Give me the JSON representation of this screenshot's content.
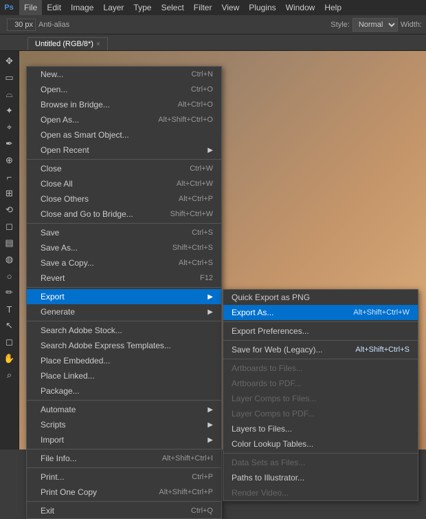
{
  "app": {
    "icon": "Ps",
    "title": "Photoshop"
  },
  "menubar": {
    "items": [
      {
        "id": "file",
        "label": "File",
        "active": true
      },
      {
        "id": "edit",
        "label": "Edit"
      },
      {
        "id": "image",
        "label": "Image"
      },
      {
        "id": "layer",
        "label": "Layer"
      },
      {
        "id": "type",
        "label": "Type"
      },
      {
        "id": "select",
        "label": "Select"
      },
      {
        "id": "filter",
        "label": "Filter"
      },
      {
        "id": "view",
        "label": "View"
      },
      {
        "id": "plugins",
        "label": "Plugins"
      },
      {
        "id": "window",
        "label": "Window"
      },
      {
        "id": "help",
        "label": "Help"
      }
    ]
  },
  "toolbar": {
    "size_value": "30 px",
    "anti_alias_label": "Anti-alias",
    "style_label": "Style:",
    "style_value": "Normal",
    "width_label": "Width:"
  },
  "tab": {
    "name": "Untitled (RGB/8*)",
    "close": "×"
  },
  "file_menu": {
    "items": [
      {
        "id": "new",
        "label": "New...",
        "shortcut": "Ctrl+N",
        "has_sub": false,
        "disabled": false
      },
      {
        "id": "open",
        "label": "Open...",
        "shortcut": "Ctrl+O",
        "has_sub": false,
        "disabled": false
      },
      {
        "id": "browse_in_bridge",
        "label": "Browse in Bridge...",
        "shortcut": "Alt+Ctrl+O",
        "has_sub": false,
        "disabled": false
      },
      {
        "id": "open_as",
        "label": "Open As...",
        "shortcut": "Alt+Shift+Ctrl+O",
        "has_sub": false,
        "disabled": false
      },
      {
        "id": "open_smart_object",
        "label": "Open as Smart Object...",
        "shortcut": "",
        "has_sub": false,
        "disabled": false
      },
      {
        "id": "open_recent",
        "label": "Open Recent",
        "shortcut": "",
        "has_sub": true,
        "disabled": false
      },
      {
        "id": "div1",
        "type": "divider"
      },
      {
        "id": "close",
        "label": "Close",
        "shortcut": "Ctrl+W",
        "has_sub": false,
        "disabled": false
      },
      {
        "id": "close_all",
        "label": "Close All",
        "shortcut": "Alt+Ctrl+W",
        "has_sub": false,
        "disabled": false
      },
      {
        "id": "close_others",
        "label": "Close Others",
        "shortcut": "Alt+Ctrl+P",
        "has_sub": false,
        "disabled": false
      },
      {
        "id": "close_go_bridge",
        "label": "Close and Go to Bridge...",
        "shortcut": "Shift+Ctrl+W",
        "has_sub": false,
        "disabled": false
      },
      {
        "id": "div2",
        "type": "divider"
      },
      {
        "id": "save",
        "label": "Save",
        "shortcut": "Ctrl+S",
        "has_sub": false,
        "disabled": false
      },
      {
        "id": "save_as",
        "label": "Save As...",
        "shortcut": "Shift+Ctrl+S",
        "has_sub": false,
        "disabled": false
      },
      {
        "id": "save_copy",
        "label": "Save a Copy...",
        "shortcut": "Alt+Ctrl+S",
        "has_sub": false,
        "disabled": false
      },
      {
        "id": "revert",
        "label": "Revert",
        "shortcut": "F12",
        "has_sub": false,
        "disabled": false
      },
      {
        "id": "div3",
        "type": "divider"
      },
      {
        "id": "export",
        "label": "Export",
        "shortcut": "",
        "has_sub": true,
        "disabled": false,
        "highlighted": true
      },
      {
        "id": "generate",
        "label": "Generate",
        "shortcut": "",
        "has_sub": true,
        "disabled": false
      },
      {
        "id": "div4",
        "type": "divider"
      },
      {
        "id": "search_stock",
        "label": "Search Adobe Stock...",
        "shortcut": "",
        "has_sub": false,
        "disabled": false
      },
      {
        "id": "search_express",
        "label": "Search Adobe Express Templates...",
        "shortcut": "",
        "has_sub": false,
        "disabled": false
      },
      {
        "id": "place_embedded",
        "label": "Place Embedded...",
        "shortcut": "",
        "has_sub": false,
        "disabled": false
      },
      {
        "id": "place_linked",
        "label": "Place Linked...",
        "shortcut": "",
        "has_sub": false,
        "disabled": false
      },
      {
        "id": "package",
        "label": "Package...",
        "shortcut": "",
        "has_sub": false,
        "disabled": false
      },
      {
        "id": "div5",
        "type": "divider"
      },
      {
        "id": "automate",
        "label": "Automate",
        "shortcut": "",
        "has_sub": true,
        "disabled": false
      },
      {
        "id": "scripts",
        "label": "Scripts",
        "shortcut": "",
        "has_sub": true,
        "disabled": false
      },
      {
        "id": "import",
        "label": "Import",
        "shortcut": "",
        "has_sub": true,
        "disabled": false
      },
      {
        "id": "div6",
        "type": "divider"
      },
      {
        "id": "file_info",
        "label": "File Info...",
        "shortcut": "Alt+Shift+Ctrl+I",
        "has_sub": false,
        "disabled": false
      },
      {
        "id": "div7",
        "type": "divider"
      },
      {
        "id": "print",
        "label": "Print...",
        "shortcut": "Ctrl+P",
        "has_sub": false,
        "disabled": false
      },
      {
        "id": "print_one",
        "label": "Print One Copy",
        "shortcut": "Alt+Shift+Ctrl+P",
        "has_sub": false,
        "disabled": false
      },
      {
        "id": "div8",
        "type": "divider"
      },
      {
        "id": "exit",
        "label": "Exit",
        "shortcut": "Ctrl+Q",
        "has_sub": false,
        "disabled": false
      }
    ]
  },
  "export_submenu": {
    "items": [
      {
        "id": "quick_export_png",
        "label": "Quick Export as PNG",
        "shortcut": "",
        "disabled": false
      },
      {
        "id": "export_as",
        "label": "Export As...",
        "shortcut": "Alt+Shift+Ctrl+W",
        "disabled": false,
        "highlighted": true
      },
      {
        "id": "div1",
        "type": "divider"
      },
      {
        "id": "export_prefs",
        "label": "Export Preferences...",
        "shortcut": "",
        "disabled": false
      },
      {
        "id": "div2",
        "type": "divider"
      },
      {
        "id": "save_for_web",
        "label": "Save for Web (Legacy)...",
        "shortcut": "Alt+Shift+Ctrl+S",
        "disabled": false
      },
      {
        "id": "div3",
        "type": "divider"
      },
      {
        "id": "artboards_to_files",
        "label": "Artboards to Files...",
        "shortcut": "",
        "disabled": true
      },
      {
        "id": "artboards_to_pdf",
        "label": "Artboards to PDF...",
        "shortcut": "",
        "disabled": true
      },
      {
        "id": "layer_comps_to_files",
        "label": "Layer Comps to Files...",
        "shortcut": "",
        "disabled": true
      },
      {
        "id": "layer_comps_to_pdf",
        "label": "Layer Comps to PDF...",
        "shortcut": "",
        "disabled": true
      },
      {
        "id": "layers_to_files",
        "label": "Layers to Files...",
        "shortcut": "",
        "disabled": false
      },
      {
        "id": "color_lookup_tables",
        "label": "Color Lookup Tables...",
        "shortcut": "",
        "disabled": false
      },
      {
        "id": "div4",
        "type": "divider"
      },
      {
        "id": "data_sets_as_files",
        "label": "Data Sets as Files...",
        "shortcut": "",
        "disabled": true
      },
      {
        "id": "paths_to_illustrator",
        "label": "Paths to Illustrator...",
        "shortcut": "",
        "disabled": false
      },
      {
        "id": "render_video",
        "label": "Render Video...",
        "shortcut": "",
        "disabled": true
      }
    ]
  },
  "left_tools": [
    {
      "id": "move",
      "icon": "✥"
    },
    {
      "id": "marquee",
      "icon": "▭"
    },
    {
      "id": "lasso",
      "icon": "⌓"
    },
    {
      "id": "magic-wand",
      "icon": "✦"
    },
    {
      "id": "crop",
      "icon": "⌖"
    },
    {
      "id": "eyedropper",
      "icon": "✒"
    },
    {
      "id": "heal",
      "icon": "⊕"
    },
    {
      "id": "brush",
      "icon": "⌐"
    },
    {
      "id": "clone",
      "icon": "⊞"
    },
    {
      "id": "history",
      "icon": "⟲"
    },
    {
      "id": "eraser",
      "icon": "◻"
    },
    {
      "id": "gradient",
      "icon": "▤"
    },
    {
      "id": "blur",
      "icon": "◍"
    },
    {
      "id": "dodge",
      "icon": "○"
    },
    {
      "id": "pen",
      "icon": "✏"
    },
    {
      "id": "type",
      "icon": "T"
    },
    {
      "id": "path-select",
      "icon": "↖"
    },
    {
      "id": "shape",
      "icon": "◻"
    },
    {
      "id": "hand",
      "icon": "✋"
    },
    {
      "id": "zoom",
      "icon": "⌕"
    }
  ]
}
